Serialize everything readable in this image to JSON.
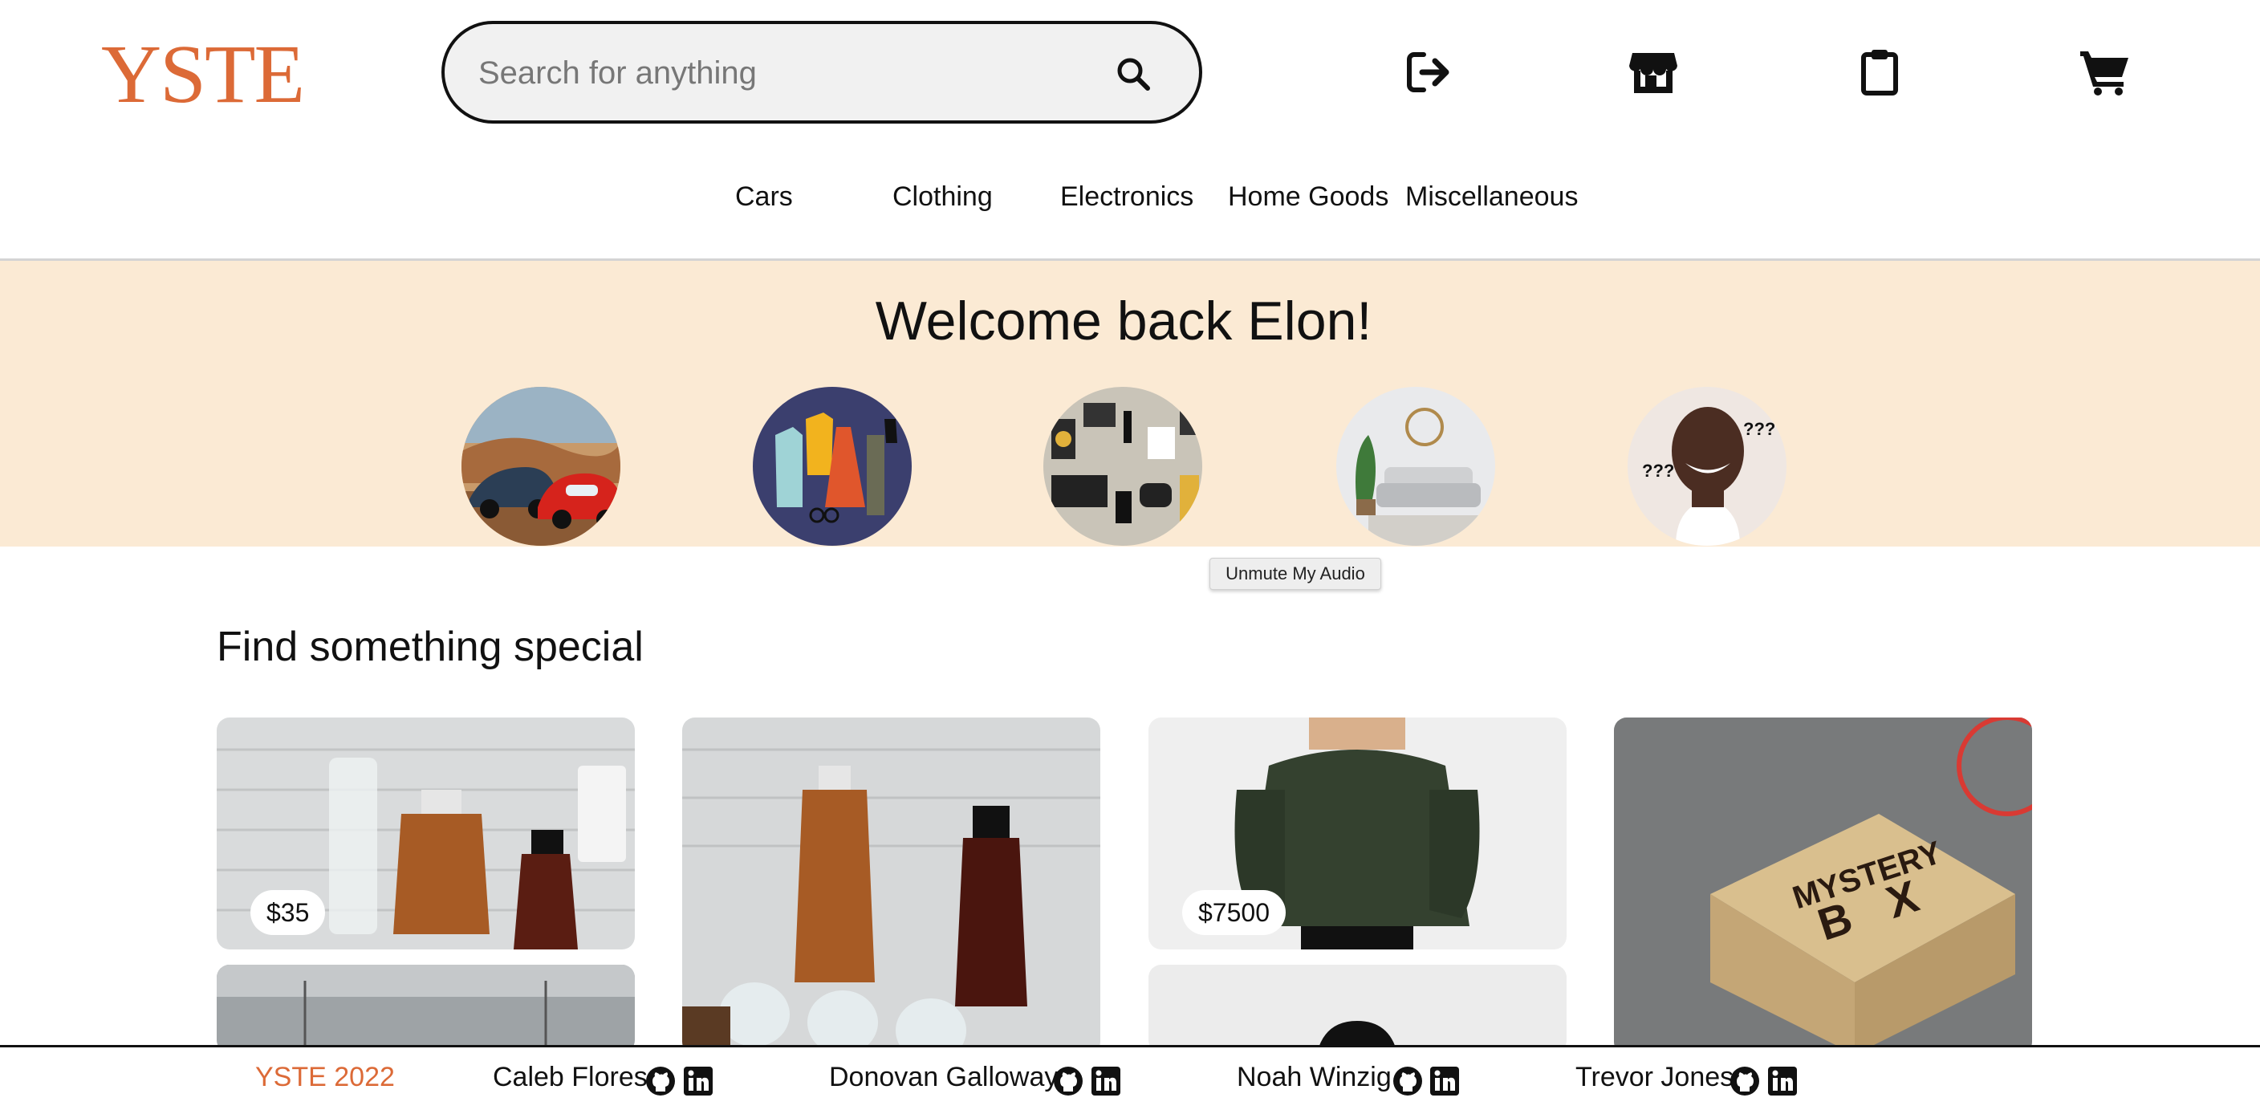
{
  "header": {
    "logo": "YSTE",
    "search_placeholder": "Search for anything",
    "icons": [
      "search-icon",
      "logout-icon",
      "storefront-icon",
      "clipboard-icon",
      "cart-icon"
    ]
  },
  "categories": [
    "Cars",
    "Clothing",
    "Electronics",
    "Home Goods",
    "Miscellaneous"
  ],
  "banner": {
    "title": "Welcome back Elon!",
    "circle_annotations": [
      "???",
      "???"
    ]
  },
  "tooltip": "Unmute My Audio",
  "main": {
    "title": "Find something special",
    "listings": [
      {
        "price": "$35"
      },
      {
        "price": ""
      },
      {
        "price": "$7500"
      },
      {
        "price": ""
      }
    ],
    "mystery_box_text": [
      "MYSTERY",
      "B",
      "X"
    ]
  },
  "footer": {
    "copyright": "YSTE 2022",
    "people": [
      "Caleb Flores",
      "Donovan Galloway",
      "Noah Winzig",
      "Trevor Jones"
    ],
    "icons": [
      "github-icon",
      "linkedin-icon"
    ]
  },
  "colors": {
    "brand": "#dc6a37",
    "banner": "#fbead4",
    "search_bg": "#f1f1f1"
  }
}
